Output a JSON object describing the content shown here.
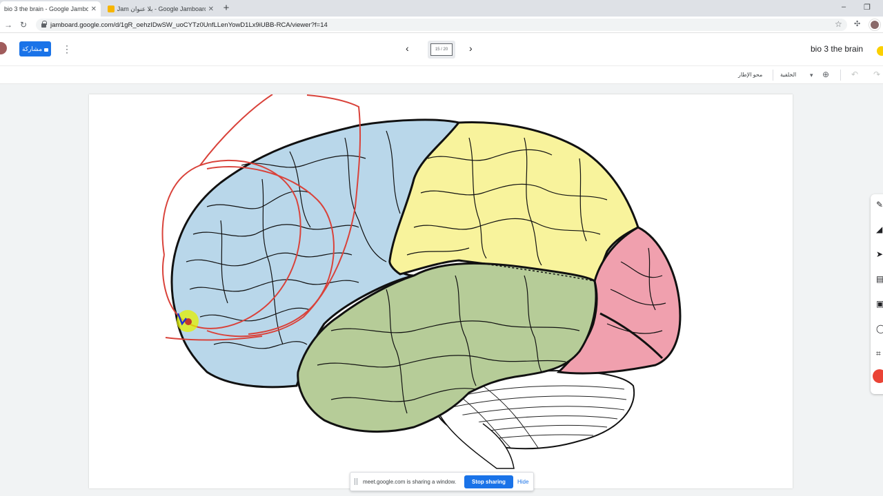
{
  "browser": {
    "tabs": [
      {
        "title": "bio 3 the brain - Google Jamboa",
        "active": true
      },
      {
        "title": "Jam بلا عنوان - Google Jamboard",
        "active": false
      }
    ],
    "new_tab_icon": "plus-icon",
    "url": "jamboard.google.com/d/1gR_oehzIDwSW_uoCYTz0UnfLLenYowD1Lx9iUBB-RCA/viewer?f=14",
    "window_controls": [
      "minimize-icon",
      "restore-icon"
    ]
  },
  "appbar": {
    "share_label": "مشاركة",
    "frame_indicator": "15 / 20",
    "doc_title": "bio 3 the brain"
  },
  "subbar": {
    "clear_frame_label": "محو الإطار",
    "background_label": "الخلفية",
    "zoom_icon": "zoom-in-icon",
    "undo_icon": "undo-icon",
    "redo_icon": "redo-icon"
  },
  "rail_tools": [
    "pen-icon",
    "eraser-icon",
    "select-icon",
    "sticky-note-icon",
    "image-icon",
    "circle-icon",
    "text-box-icon",
    "laser-icon"
  ],
  "meet": {
    "message": "meet.google.com is sharing a window.",
    "stop_label": "Stop sharing",
    "hide_label": "Hide"
  },
  "colors": {
    "frontal_lobe": "#b9d7ea",
    "parietal_lobe": "#f8f39c",
    "occipital_lobe": "#f0a0ae",
    "temporal_lobe": "#b6cc98",
    "annotation_stroke": "#d9423a",
    "accent_blue": "#1a73e8"
  }
}
